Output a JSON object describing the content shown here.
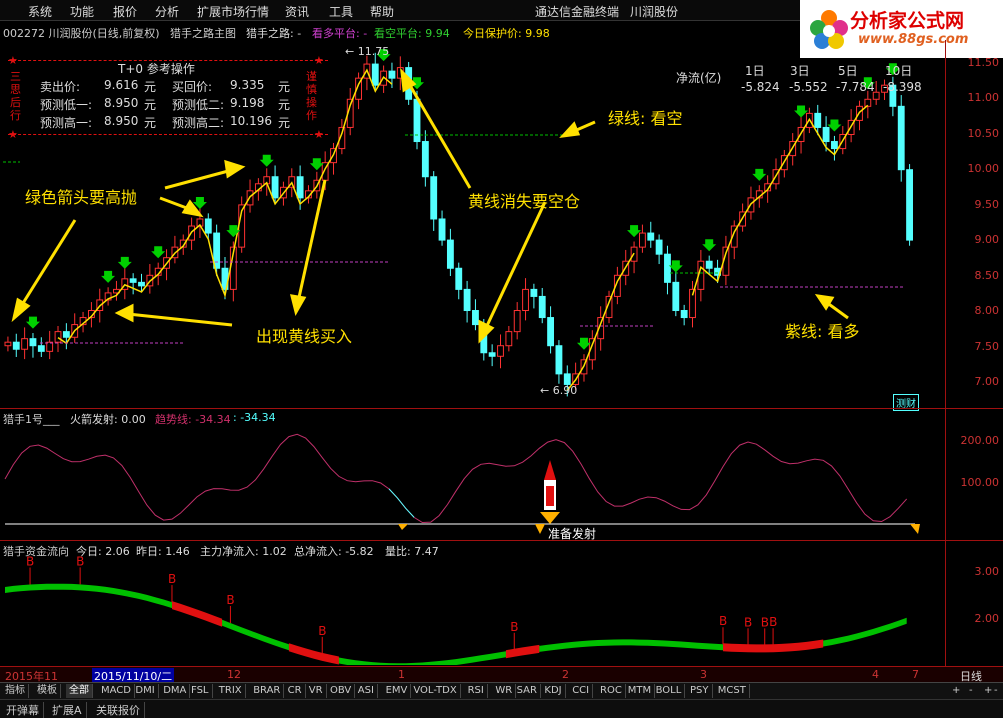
{
  "menubar": {
    "items": [
      "系统",
      "功能",
      "报价",
      "分析",
      "扩展市场行情",
      "资讯",
      "工具",
      "帮助"
    ],
    "app_title": "通达信金融终端",
    "stock_title": "川润股份"
  },
  "logo": {
    "name": "分析家公式网",
    "url": "www.88gs.com"
  },
  "header": {
    "code_name": "002272 川润股份(日线,前复权)",
    "main_formula": "猎手之路主图",
    "hunter_road": "猎手之路: -",
    "bull_platform": "看多平台: -",
    "bear_platform": "看空平台: 9.94",
    "protect_price": "今日保护价: 9.98"
  },
  "t0": {
    "title": "T+0 参考操作",
    "sell_label": "卖出价:",
    "sell_value": "9.616",
    "buyback_label": "买回价:",
    "buyback_value": "9.335",
    "low1_label": "预测低一:",
    "low1_value": "8.950",
    "low2_label": "预测低二:",
    "low2_value": "9.198",
    "high1_label": "预测高一:",
    "high1_value": "8.950",
    "high2_label": "预测高二:",
    "high2_value": "10.196",
    "unit": "元",
    "side_left": "三思后行",
    "side_right": "谨慎操作"
  },
  "netflow": {
    "label": "净流(亿)",
    "periods": [
      "1日",
      "3日",
      "5日",
      "10日"
    ],
    "values": [
      "-5.824",
      "-5.552",
      "-7.784",
      "-8.398"
    ]
  },
  "price_axis": [
    "11.50",
    "11.00",
    "10.50",
    "10.00",
    "9.50",
    "9.00",
    "8.50",
    "8.00",
    "7.50",
    "7.00"
  ],
  "price_marks": {
    "high": "11.75",
    "low": "6.90"
  },
  "annotations": {
    "green_line": "绿线: 看空",
    "purple_line": "紫线: 看多",
    "green_arrow": "绿色箭头要高抛",
    "yellow_appear": "出现黄线买入",
    "yellow_gone": "黄线消失要空仓"
  },
  "panel2": {
    "name": "猎手1号___",
    "rocket": "火箭发射: 0.00",
    "trend": "趋势线: -34.34",
    "trend2": ": -34.34",
    "axis": [
      "200.00",
      "100.00"
    ],
    "ready": "准备发射",
    "badge": "测财"
  },
  "panel3": {
    "name": "猎手资金流向",
    "today": "今日: 2.06",
    "yesterday": "昨日: 1.46",
    "main_flow": "主力净流入: 1.02",
    "total_flow": "总净流入: -5.82",
    "volume_ratio": "量比: 7.47",
    "axis": [
      "3.00",
      "2.00"
    ],
    "marker": "B"
  },
  "date_bar": {
    "labels": [
      "2015年11",
      "2015/11/10/二",
      "12",
      "1",
      "2",
      "3",
      "4",
      "7"
    ],
    "period": "日线"
  },
  "tabs": [
    "指标",
    "模板",
    "全部",
    "MACD",
    "DMI",
    "DMA",
    "FSL",
    "TRIX",
    "BRAR",
    "CR",
    "VR",
    "OBV",
    "ASI",
    "EMV",
    "VOL-TDX",
    "RSI",
    "WR",
    "SAR",
    "KDJ",
    "CCI",
    "ROC",
    "MTM",
    "BOLL",
    "PSY",
    "MCST"
  ],
  "tab_controls": [
    "+",
    "-",
    "+",
    "-"
  ],
  "status_tabs": [
    "开弹幕",
    "扩展A",
    "关联报价"
  ],
  "colors": {
    "up": "#ff3232",
    "down": "#54ffff",
    "yellow": "#ffe000",
    "purple": "#c040c0",
    "green": "#00c000",
    "pink": "#c0306a"
  }
}
